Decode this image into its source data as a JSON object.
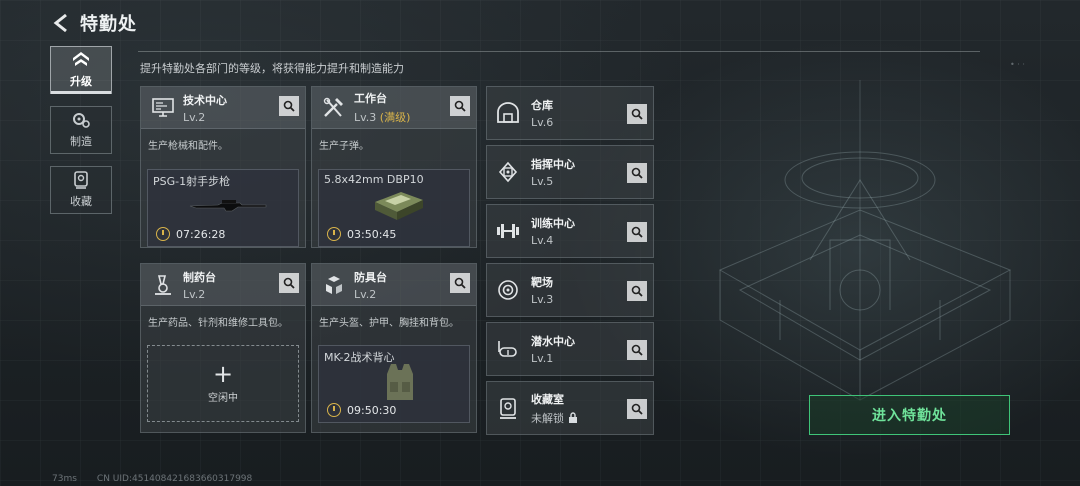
{
  "header": {
    "title": "特勤处"
  },
  "nav": [
    {
      "label": "升级",
      "icon": "upgrade-icon",
      "active": true
    },
    {
      "label": "制造",
      "icon": "gears-icon",
      "active": false
    },
    {
      "label": "收藏",
      "icon": "collection-icon",
      "active": false
    }
  ],
  "subtitle": "提升特勤处各部门的等级，将获得能力提升和制造能力",
  "cards": {
    "tech": {
      "name": "技术中心",
      "level": "Lv.2",
      "desc": "生产枪械和配件。",
      "product": "PSG-1射手步枪",
      "timer": "07:26:28"
    },
    "workbench": {
      "name": "工作台",
      "level": "Lv.3",
      "level_note": "(满级)",
      "desc": "生产子弹。",
      "product": "5.8x42mm DBP10",
      "timer": "03:50:45"
    },
    "pharmacy": {
      "name": "制药台",
      "level": "Lv.2",
      "desc": "生产药品、针剂和维修工具包。",
      "idle_label": "空闲中"
    },
    "armor": {
      "name": "防具台",
      "level": "Lv.2",
      "desc": "生产头盔、护甲、胸挂和背包。",
      "product": "MK-2战术背心",
      "timer": "09:50:30"
    }
  },
  "side": [
    {
      "name": "仓库",
      "level": "Lv.6",
      "icon": "warehouse-icon"
    },
    {
      "name": "指挥中心",
      "level": "Lv.5",
      "icon": "chip-icon"
    },
    {
      "name": "训练中心",
      "level": "Lv.4",
      "icon": "dumbbell-icon"
    },
    {
      "name": "靶场",
      "level": "Lv.3",
      "icon": "target-icon"
    },
    {
      "name": "潜水中心",
      "level": "Lv.1",
      "icon": "diving-mask-icon"
    },
    {
      "name": "收藏室",
      "level": "未解锁",
      "icon": "trophy-icon",
      "locked": true
    }
  ],
  "enter_button": "进入特勤处",
  "footer": {
    "ping": "73ms",
    "uid": "CN UID:451408421683660317998"
  },
  "colors": {
    "accent_green": "#3fc478",
    "max_gold": "#d8b34a"
  }
}
